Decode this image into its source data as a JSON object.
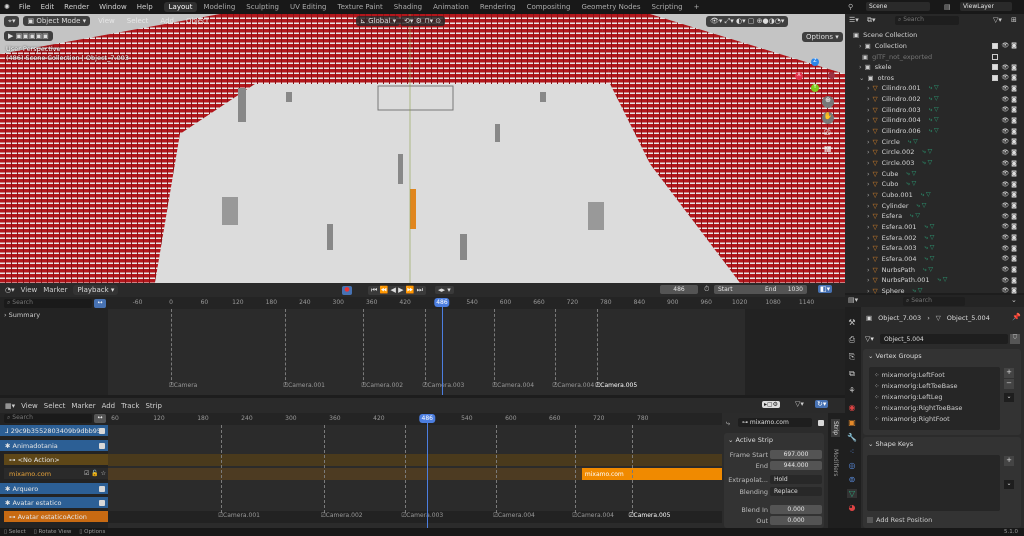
{
  "topbar": {
    "menu": [
      "File",
      "Edit",
      "Render",
      "Window",
      "Help"
    ],
    "workspaces": [
      "Layout",
      "Modeling",
      "Sculpting",
      "UV Editing",
      "Texture Paint",
      "Shading",
      "Animation",
      "Rendering",
      "Compositing",
      "Geometry Nodes",
      "Scripting"
    ],
    "active_workspace": "Layout",
    "add_tab": "+",
    "scene": "Scene",
    "view_layer": "ViewLayer"
  },
  "viewport": {
    "mode": "Object Mode",
    "menu": [
      "View",
      "Select",
      "Add",
      "Object"
    ],
    "transform_orientation": "Global",
    "options_label": "Options",
    "overlay_line1": "User Perspective",
    "overlay_line2": "(486) Scene Collection | Object_7.003",
    "gizmo": {
      "x": "X",
      "y": "Y",
      "z": "Z"
    }
  },
  "timeline": {
    "menu": [
      "View",
      "Marker",
      "Playback"
    ],
    "search_placeholder": "Search",
    "summary": "Summary",
    "current_frame": "486",
    "start_label": "Start",
    "start": "1",
    "end_label": "End",
    "end": "1030",
    "ticks": [
      "-60",
      "0",
      "60",
      "120",
      "180",
      "240",
      "300",
      "360",
      "420",
      "540",
      "600",
      "660",
      "720",
      "780",
      "840",
      "900",
      "960",
      "1020",
      "1080",
      "1140"
    ],
    "markers": [
      "Camera",
      "Camera.001",
      "Camera.002",
      "Camera.003",
      "Camera.004",
      "Camera.004",
      "Camera.005"
    ]
  },
  "nla": {
    "menu": [
      "View",
      "Select",
      "Marker",
      "Add",
      "Track",
      "Strip"
    ],
    "search_placeholder": "Search",
    "current_frame": "486",
    "ticks": [
      "60",
      "120",
      "180",
      "240",
      "300",
      "360",
      "420",
      "540",
      "600",
      "660",
      "720",
      "780"
    ],
    "channels": [
      {
        "label": "29c9b3552803409b9dbb958",
        "kind": "object"
      },
      {
        "label": "Animadotania",
        "kind": "object"
      },
      {
        "label": "<No Action>",
        "kind": "action-slot"
      },
      {
        "label": "mixamo.com",
        "kind": "track"
      },
      {
        "label": "Arquero",
        "kind": "object"
      },
      {
        "label": "Avatar estatico",
        "kind": "object"
      },
      {
        "label": "Avatar estaticoAction",
        "kind": "action"
      }
    ],
    "strip": {
      "label": "mixamo.com",
      "frame_start": 697,
      "frame_end": 944,
      "color": "#f08a00"
    },
    "markers": [
      "Camera.001",
      "Camera.002",
      "Camera.003",
      "Camera.004",
      "Camera.004",
      "Camera.005"
    ],
    "sidebar": {
      "strip_name": "mixamo.com",
      "panel": "Active Strip",
      "frame_start_label": "Frame Start",
      "frame_start": "697.000",
      "end_label": "End",
      "end": "944.000",
      "extrapolation_label": "Extrapolat...",
      "extrapolation": "Hold",
      "blending_label": "Blending",
      "blending": "Replace",
      "blend_in_label": "Blend In",
      "blend_in": "0.000",
      "out_label": "Out",
      "out": "0.000",
      "tabs": [
        "Strip",
        "Modifiers"
      ]
    }
  },
  "outliner": {
    "search_placeholder": "Search",
    "root": "Scene Collection",
    "rows": [
      {
        "label": "Collection",
        "type": "collection",
        "checked": true
      },
      {
        "label": "glTF_not_exported",
        "type": "collection",
        "checked": false,
        "dim": true
      },
      {
        "label": "skele",
        "type": "collection",
        "checked": true
      },
      {
        "label": "otros",
        "type": "collection",
        "checked": true,
        "expanded": true
      },
      {
        "label": "Cilindro.001",
        "type": "mesh"
      },
      {
        "label": "Cilindro.002",
        "type": "mesh"
      },
      {
        "label": "Cilindro.003",
        "type": "mesh"
      },
      {
        "label": "Cilindro.004",
        "type": "mesh"
      },
      {
        "label": "Cilindro.006",
        "type": "mesh"
      },
      {
        "label": "Circle",
        "type": "mesh"
      },
      {
        "label": "Circle.002",
        "type": "mesh"
      },
      {
        "label": "Circle.003",
        "type": "mesh"
      },
      {
        "label": "Cube",
        "type": "mesh"
      },
      {
        "label": "Cubo",
        "type": "mesh"
      },
      {
        "label": "Cubo.001",
        "type": "mesh"
      },
      {
        "label": "Cylinder",
        "type": "mesh"
      },
      {
        "label": "Esfera",
        "type": "mesh"
      },
      {
        "label": "Esfera.001",
        "type": "mesh"
      },
      {
        "label": "Esfera.002",
        "type": "mesh"
      },
      {
        "label": "Esfera.003",
        "type": "mesh"
      },
      {
        "label": "Esfera.004",
        "type": "mesh"
      },
      {
        "label": "NurbsPath",
        "type": "mesh"
      },
      {
        "label": "NurbsPath.001",
        "type": "mesh"
      },
      {
        "label": "Sphere",
        "type": "mesh"
      }
    ]
  },
  "properties": {
    "search_placeholder": "Search",
    "breadcrumb_object": "Object_7.003",
    "breadcrumb_data": "Object_5.004",
    "data_name": "Object_5.004",
    "vertex_groups_title": "Vertex Groups",
    "vertex_groups": [
      "mixamorig:LeftFoot",
      "mixamorig:LeftToeBase",
      "mixamorig:LeftLeg",
      "mixamorig:RightToeBase",
      "mixamorig:RightFoot"
    ],
    "shape_keys_title": "Shape Keys",
    "add_rest_position": "Add Rest Position"
  },
  "statusbar": {
    "items": [
      "Select",
      "Rotate View",
      "Options"
    ],
    "version": "5.1.0"
  }
}
